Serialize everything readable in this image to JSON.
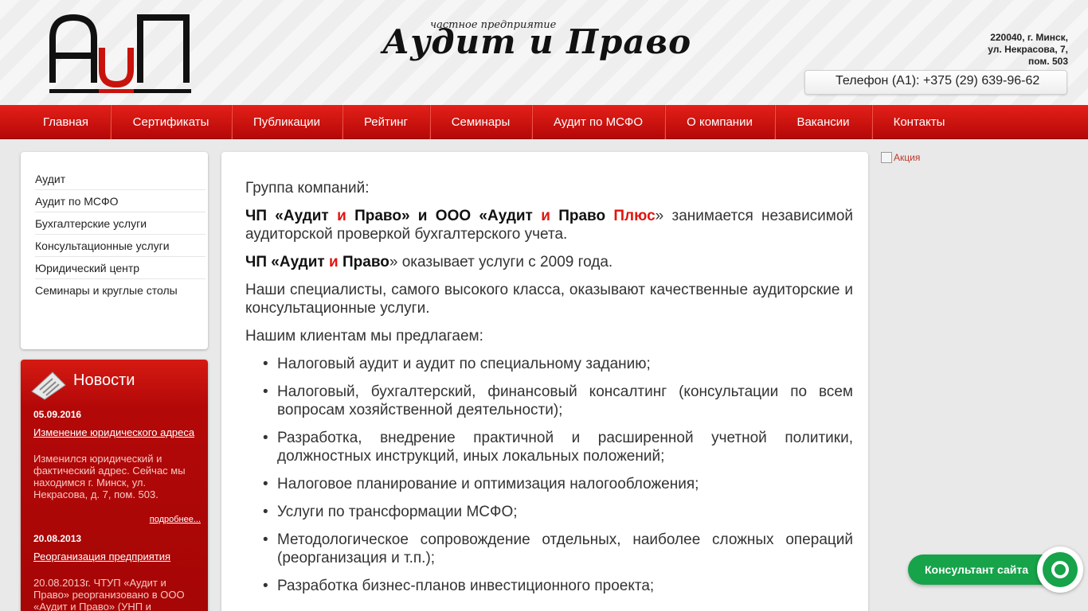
{
  "header": {
    "logo_text": "АиП",
    "brand_subtitle": "частное предприятие",
    "brand_title": "Аудит и Право",
    "address_line1": "220040, г. Минск,",
    "address_line2": "ул. Некрасова, 7,",
    "address_line3": "пом. 503",
    "phone": "Телефон (А1): +375 (29) 639-96-62"
  },
  "nav": {
    "items": [
      {
        "label": "Главная"
      },
      {
        "label": "Сертификаты"
      },
      {
        "label": "Публикации"
      },
      {
        "label": "Рейтинг"
      },
      {
        "label": "Семинары"
      },
      {
        "label": "Аудит по МСФО"
      },
      {
        "label": "О компании"
      },
      {
        "label": "Вакансии"
      },
      {
        "label": "Контакты"
      }
    ]
  },
  "sidebar": {
    "items": [
      {
        "label": "Аудит"
      },
      {
        "label": "Аудит по МСФО"
      },
      {
        "label": "Бухгалтерские услуги"
      },
      {
        "label": "Консультационные услуги"
      },
      {
        "label": "Юридический центр"
      },
      {
        "label": "Семинары и круглые столы"
      }
    ]
  },
  "news": {
    "title": "Новости",
    "entries": [
      {
        "date": "05.09.2016",
        "link": "Изменение юридического адреса",
        "text": "Изменился юридический и фактический адрес. Сейчас мы находимся г. Минск, ул. Некрасова, д. 7, пом. 503.",
        "more": "подробнее..."
      },
      {
        "date": "20.08.2013",
        "link": "Реорганизация предприятия",
        "text": "20.08.2013г. ЧТУП «Аудит и Право» реорганизовано в ООО «Аудит и Право» (УНП  и"
      }
    ]
  },
  "content": {
    "intro": "Группа компаний:",
    "p1_prefix": "ЧП «",
    "p1_company_a": "Аудит",
    "p1_and": "и",
    "p1_company_b": "Право",
    "p1_mid": "» и ООО «",
    "p1_company_c": "Аудит",
    "p1_and2": "и",
    "p1_company_d": "Право",
    "p1_plus": "Плюс",
    "p1_suffix": "» занимается независимой аудиторской проверкой бухгалтерского учета.",
    "p2_prefix": "ЧП «",
    "p2_a": "Аудит",
    "p2_and": "и",
    "p2_b": "Право",
    "p2_suffix": "» оказывает услуги с 2009 года.",
    "p3": "Наши специалисты, самого высокого класса, оказывают качественные аудиторские и консультационные услуги.",
    "p4": "Нашим клиентам мы предлагаем:",
    "services": [
      "Налоговый аудит и аудит по специальному заданию;",
      "Налоговый, бухгалтерский, финансовый консалтинг  (консультации по всем вопросам хозяйственной  деятельности);",
      "Разработка, внедрение практичной и расширенной учетной политики, должностных инструкций, иных локальных положений;",
      "Налоговое планирование и оптимизация налогообложения;",
      "Услуги по трансформации МСФО;",
      "Методологическое сопровождение отдельных, наиболее сложных операций (реорганизация и т.п.);",
      "Разработка бизнес-планов инвестиционного проекта;"
    ]
  },
  "promo": {
    "alt": "Акция"
  },
  "consultant": {
    "label": "Консультант сайта"
  },
  "colors": {
    "accent": "#d0120b",
    "widget": "#16a34a"
  }
}
